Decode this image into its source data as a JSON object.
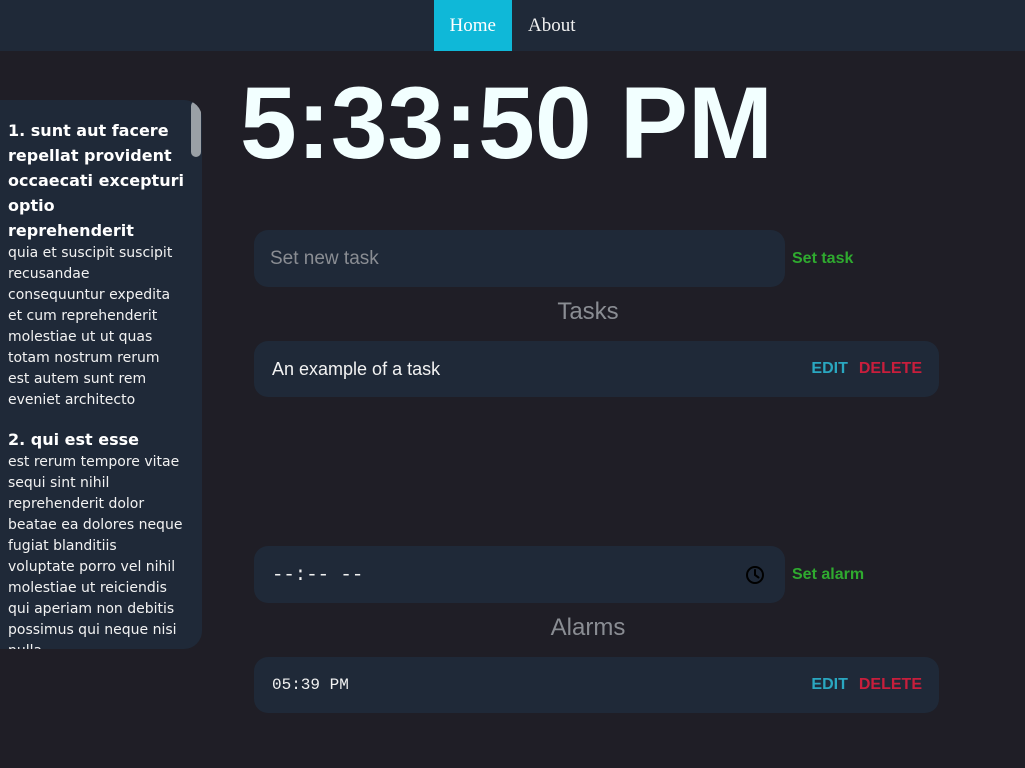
{
  "nav": {
    "home": "Home",
    "about": "About"
  },
  "sidebar": {
    "posts": [
      {
        "title": "1. sunt aut facere repellat provident occaecati excepturi optio reprehenderit",
        "body": "quia et suscipit suscipit recusandae consequuntur expedita et cum reprehenderit molestiae ut ut quas totam nostrum rerum est autem sunt rem eveniet architecto"
      },
      {
        "title": "2. qui est esse",
        "body": "est rerum tempore vitae sequi sint nihil reprehenderit dolor beatae ea dolores neque fugiat blanditiis voluptate porro vel nihil molestiae ut reiciendis qui aperiam non debitis possimus qui neque nisi nulla"
      }
    ]
  },
  "clock": {
    "time": "5:33:50 PM"
  },
  "tasks": {
    "input_placeholder": "Set new task",
    "input_value": "",
    "set_label": "Set task",
    "heading": "Tasks",
    "items": [
      {
        "text": "An example of a task",
        "edit": "EDIT",
        "delete": "DELETE"
      }
    ]
  },
  "alarms": {
    "input_display": "--:-- --",
    "set_label": "Set alarm",
    "heading": "Alarms",
    "items": [
      {
        "text": "05:39 PM",
        "edit": "EDIT",
        "delete": "DELETE"
      }
    ]
  },
  "colors": {
    "accent": "#0fb8d8",
    "set_green": "#2faa2f",
    "edit_teal": "#2aa7c0",
    "delete_red": "#c81e3c"
  },
  "icons": {
    "alarm_time_picker": "clock-icon"
  }
}
